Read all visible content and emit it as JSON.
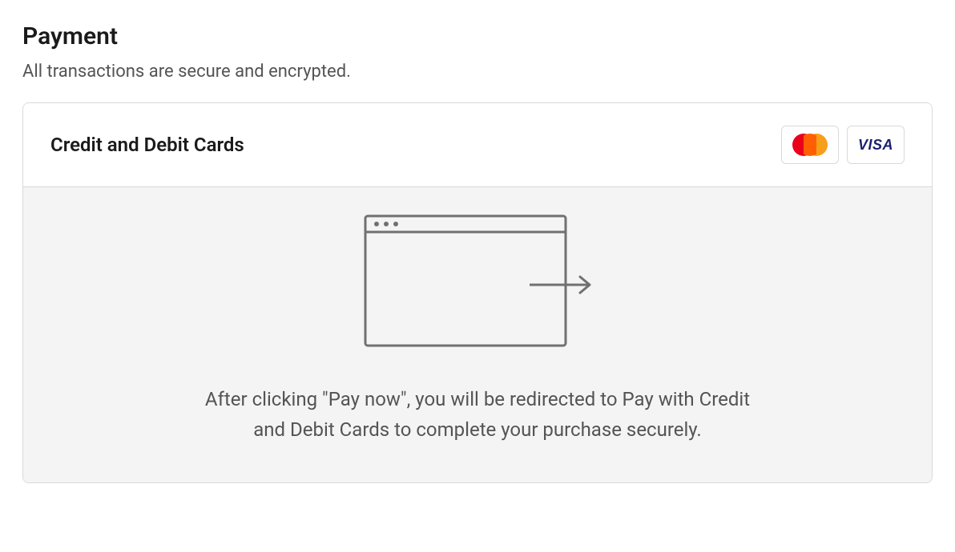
{
  "payment": {
    "title": "Payment",
    "subtitle": "All transactions are secure and encrypted.",
    "method_label": "Credit and Debit Cards",
    "card_brands": [
      "mastercard",
      "visa"
    ],
    "redirect_message": "After clicking \"Pay now\", you will be redirected to Pay with Credit and Debit Cards to complete your purchase securely."
  }
}
